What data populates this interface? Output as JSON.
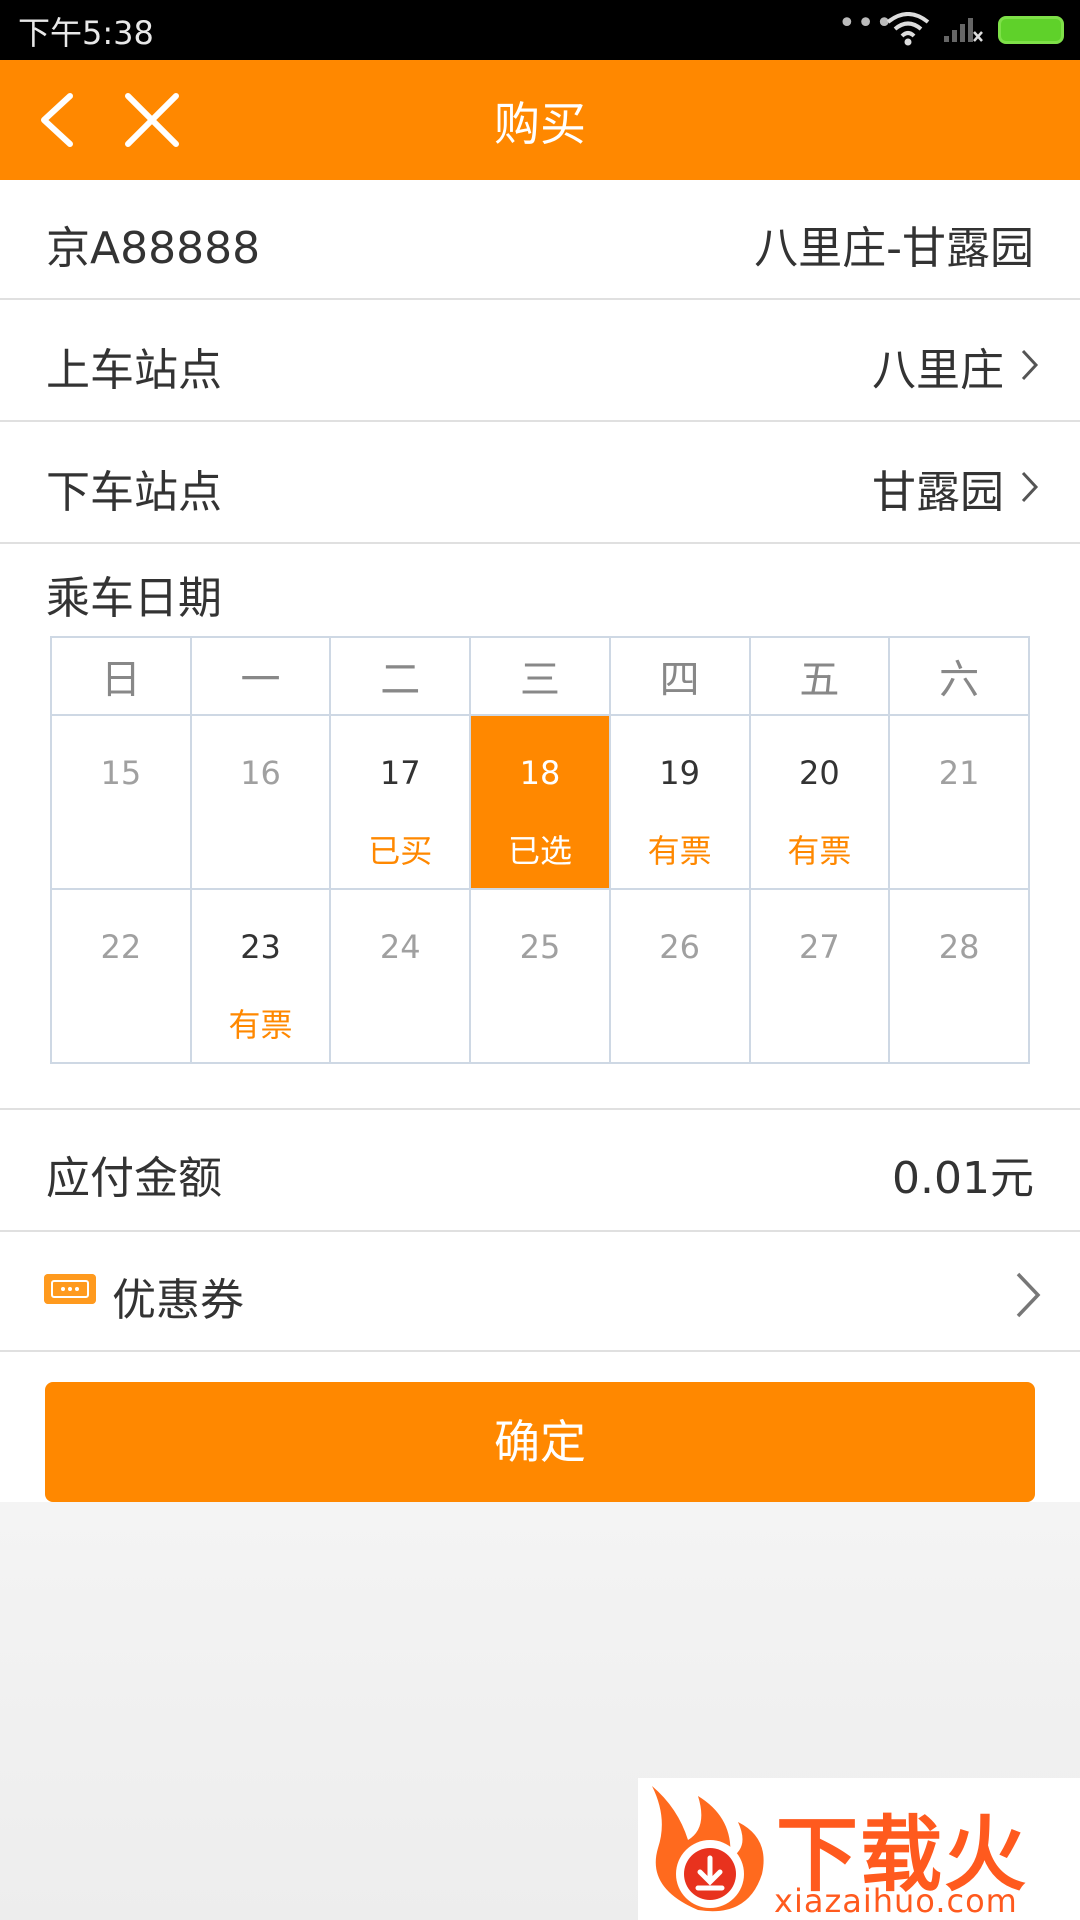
{
  "status_bar": {
    "time": "下午5:38",
    "dots": "•••"
  },
  "app_bar": {
    "title": "购买"
  },
  "route": {
    "plate": "京A88888",
    "line": "八里庄-甘露园"
  },
  "boarding": {
    "label": "上车站点",
    "value": "八里庄"
  },
  "alighting": {
    "label": "下车站点",
    "value": "甘露园"
  },
  "date": {
    "label": "乘车日期",
    "weekdays": [
      "日",
      "一",
      "二",
      "三",
      "四",
      "五",
      "六"
    ],
    "weeks": [
      [
        {
          "day": "15",
          "status": "",
          "available": false,
          "selected": false
        },
        {
          "day": "16",
          "status": "",
          "available": false,
          "selected": false
        },
        {
          "day": "17",
          "status": "已买",
          "available": true,
          "selected": false
        },
        {
          "day": "18",
          "status": "已选",
          "available": true,
          "selected": true
        },
        {
          "day": "19",
          "status": "有票",
          "available": true,
          "selected": false
        },
        {
          "day": "20",
          "status": "有票",
          "available": true,
          "selected": false
        },
        {
          "day": "21",
          "status": "",
          "available": false,
          "selected": false
        }
      ],
      [
        {
          "day": "22",
          "status": "",
          "available": false,
          "selected": false
        },
        {
          "day": "23",
          "status": "有票",
          "available": true,
          "selected": false
        },
        {
          "day": "24",
          "status": "",
          "available": false,
          "selected": false
        },
        {
          "day": "25",
          "status": "",
          "available": false,
          "selected": false
        },
        {
          "day": "26",
          "status": "",
          "available": false,
          "selected": false
        },
        {
          "day": "27",
          "status": "",
          "available": false,
          "selected": false
        },
        {
          "day": "28",
          "status": "",
          "available": false,
          "selected": false
        }
      ]
    ]
  },
  "amount": {
    "label": "应付金额",
    "value": "0.01元"
  },
  "coupon": {
    "label": "优惠券",
    "icon": "ticket-icon"
  },
  "confirm": {
    "label": "确定"
  },
  "watermark": {
    "text": "下载火",
    "url": "xiazaihuo.com"
  },
  "colors": {
    "accent": "#ff8800",
    "status_bar": "#000000",
    "text": "#333333",
    "muted": "#a0a0a0",
    "grid": "#ced8e4"
  }
}
